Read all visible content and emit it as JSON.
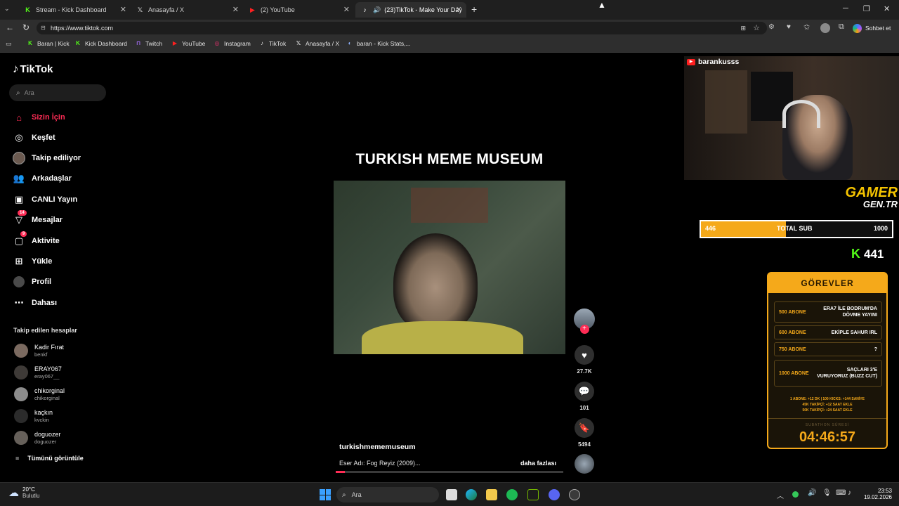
{
  "browser": {
    "tabs": [
      {
        "label": "Stream - Kick Dashboard",
        "icon": "kick-icon",
        "active": false
      },
      {
        "label": "Anasayfa / X",
        "icon": "x-icon",
        "active": false
      },
      {
        "label": "(2) YouTube",
        "icon": "youtube-icon",
        "active": false
      },
      {
        "label": "(23)TikTok - Make Your Day",
        "icon": "tiktok-icon",
        "active": true
      }
    ],
    "url": "https://www.tiktok.com",
    "copilot_label": "Sohbet et",
    "bookmarks": [
      {
        "label": "Baran | Kick",
        "icon": "kick-icon"
      },
      {
        "label": "Kick Dashboard",
        "icon": "kick-icon"
      },
      {
        "label": "Twitch",
        "icon": "twitch-icon"
      },
      {
        "label": "YouTube",
        "icon": "youtube-icon"
      },
      {
        "label": "Instagram",
        "icon": "instagram-icon"
      },
      {
        "label": "TikTok",
        "icon": "tiktok-icon"
      },
      {
        "label": "Anasayfa / X",
        "icon": "x-icon"
      },
      {
        "label": "baran - Kick Stats,...",
        "icon": "stats-icon"
      }
    ]
  },
  "tiktok": {
    "logo": "TikTok",
    "search_placeholder": "Ara",
    "nav": [
      {
        "label": "Sizin İçin",
        "icon": "home-icon",
        "active": true
      },
      {
        "label": "Keşfet",
        "icon": "compass-icon"
      },
      {
        "label": "Takip ediliyor",
        "icon": "following-avatar-icon"
      },
      {
        "label": "Arkadaşlar",
        "icon": "friends-icon"
      },
      {
        "label": "CANLI Yayın",
        "icon": "live-icon"
      },
      {
        "label": "Mesajlar",
        "icon": "messages-icon",
        "badge": "14"
      },
      {
        "label": "Aktivite",
        "icon": "activity-icon",
        "badge": "9"
      },
      {
        "label": "Yükle",
        "icon": "upload-icon"
      },
      {
        "label": "Profil",
        "icon": "profile-avatar-icon"
      },
      {
        "label": "Dahası",
        "icon": "more-icon"
      }
    ],
    "following_title": "Takip edilen hesaplar",
    "accounts": [
      {
        "name": "Kadir Fırat",
        "handle": "benkf"
      },
      {
        "name": "ERAY067",
        "handle": "eray067__"
      },
      {
        "name": "chikorginal",
        "handle": "chikorginal"
      },
      {
        "name": "kaçkın",
        "handle": "kvckin"
      },
      {
        "name": "doguozer",
        "handle": "doguozer"
      }
    ],
    "see_all": "Tümünü görüntüle",
    "video": {
      "caption_title": "TURKISH MEME MUSEUM",
      "author": "turkishmememuseum",
      "description": "Eser Adı: Fog Reyiz (2009)...",
      "more": "daha fazlası",
      "likes": "27.7K",
      "comments": "101",
      "saves": "5494"
    }
  },
  "overlay": {
    "streamer": "barankusss",
    "brand_line1": "GAMER",
    "brand_line2": "GEN.TR",
    "sub_current": "446",
    "sub_label": "TOTAL SUB",
    "sub_goal": "1000",
    "sub_progress": 0.446,
    "kick_count": "441",
    "quests_title": "GÖREVLER",
    "quests": [
      {
        "amount": "500 ABONE",
        "task": "ERA7 İLE BODRUM'DA DÖVME YAYINI"
      },
      {
        "amount": "600 ABONE",
        "task": "EKİPLE SAHUR IRL"
      },
      {
        "amount": "750 ABONE",
        "task": "?"
      },
      {
        "amount": "1000 ABONE",
        "task": "SAÇLARI 3'E VURUYORUZ (BUZZ CUT)"
      }
    ],
    "rules_line1": "1 ABONE: +12 DK | 100 KICKS: +144 SANİYE",
    "rules_line2": "45K TAKİPÇİ: +12 SAAT EKLE",
    "rules_line3": "50K TAKİPÇİ: +24 SAAT EKLE",
    "timer_label": "SUBATHON SÜRESİ",
    "timer": "04:46:57"
  },
  "taskbar": {
    "weather_temp": "20°C",
    "weather_desc": "Bulutlu",
    "search": "Ara",
    "time": "23:53",
    "date": "19.02.2026"
  },
  "colors": {
    "tiktok_accent": "#fe2c55",
    "overlay_gold": "#f5a91a",
    "kick_green": "#53fc18"
  }
}
